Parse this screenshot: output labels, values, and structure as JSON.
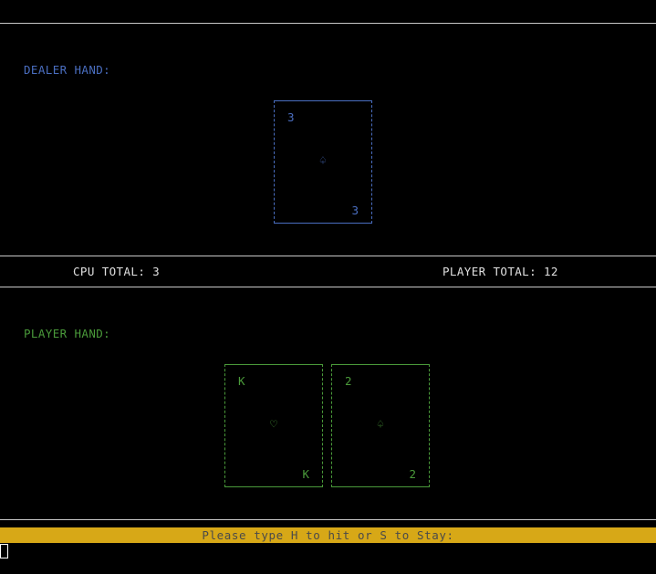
{
  "dealer": {
    "label": "DEALER HAND:",
    "cards": [
      {
        "rank": "3",
        "suit": "♤",
        "suit_name": "spade-icon"
      }
    ]
  },
  "player": {
    "label": "PLAYER HAND:",
    "cards": [
      {
        "rank": "K",
        "suit": "♡",
        "suit_name": "heart-icon"
      },
      {
        "rank": "2",
        "suit": "♤",
        "suit_name": "spade-icon"
      }
    ]
  },
  "totals": {
    "cpu": "CPU TOTAL: 3",
    "player": "PLAYER TOTAL: 12"
  },
  "prompt": {
    "text": "Please type H to hit or S to Stay:"
  },
  "colors": {
    "dealer": "#4a6ec0",
    "player": "#4a9a3a",
    "prompt_bar": "#d7a817",
    "background": "#000000"
  }
}
